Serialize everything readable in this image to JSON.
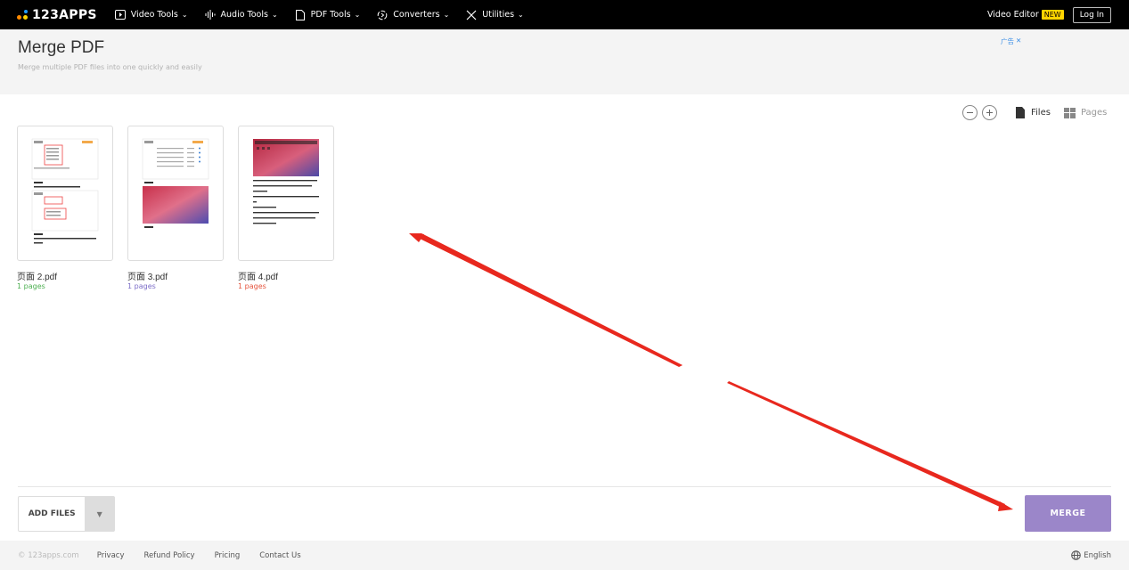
{
  "nav": {
    "logo_text": "123APPS",
    "items": [
      {
        "label": "Video Tools",
        "icon": "video-icon"
      },
      {
        "label": "Audio Tools",
        "icon": "audio-wave-icon"
      },
      {
        "label": "PDF Tools",
        "icon": "pdf-icon"
      },
      {
        "label": "Converters",
        "icon": "convert-icon"
      },
      {
        "label": "Utilities",
        "icon": "tools-icon"
      }
    ],
    "video_editor": "Video Editor",
    "badge_new": "NEW",
    "login": "Log In"
  },
  "header": {
    "title": "Merge PDF",
    "subtitle": "Merge multiple PDF files into one quickly and easily",
    "ad_label": "广告",
    "ad_close": "✕"
  },
  "view": {
    "files_label": "Files",
    "pages_label": "Pages"
  },
  "files": [
    {
      "name": "页面 2.pdf",
      "pages": "1 pages",
      "pages_color": "#4caf50"
    },
    {
      "name": "页面 3.pdf",
      "pages": "1 pages",
      "pages_color": "#7b6cc7"
    },
    {
      "name": "页面 4.pdf",
      "pages": "1 pages",
      "pages_color": "#e5533c"
    }
  ],
  "bottom": {
    "add_files": "ADD FILES",
    "merge": "MERGE"
  },
  "footer": {
    "copyright": "© 123apps.com",
    "links": [
      "Privacy",
      "Refund Policy",
      "Pricing",
      "Contact Us"
    ],
    "language": "English"
  },
  "colors": {
    "merge_button": "#9b86c9",
    "arrow": "#e8281e",
    "badge": "#ffd400"
  }
}
